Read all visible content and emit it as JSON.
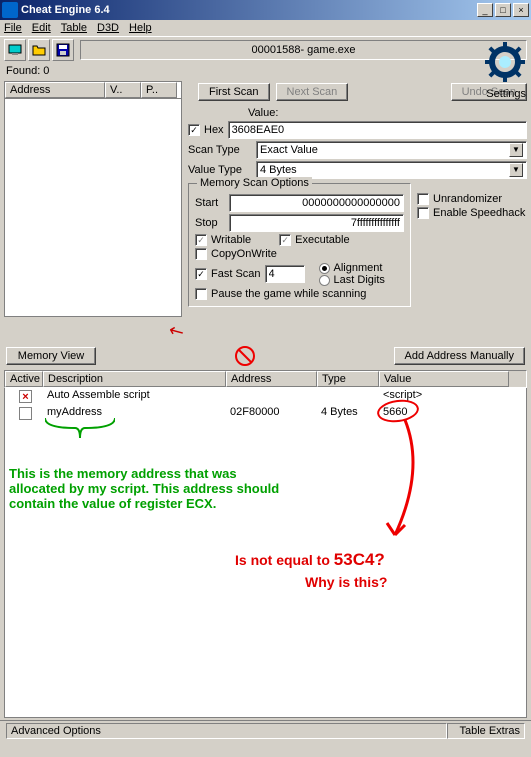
{
  "window": {
    "title": "Cheat Engine 6.4"
  },
  "menu": {
    "file": "File",
    "edit": "Edit",
    "table": "Table",
    "d3d": "D3D",
    "help": "Help"
  },
  "process": "00001588- game.exe",
  "settings": "Settings",
  "found": {
    "label": "Found: 0"
  },
  "list_headers": {
    "address": "Address",
    "value": "V..",
    "prev": "P.."
  },
  "buttons": {
    "first_scan": "First Scan",
    "next_scan": "Next Scan",
    "undo_scan": "Undo Scan",
    "memory_view": "Memory View",
    "add_manual": "Add Address Manually",
    "advanced": "Advanced Options",
    "extras": "Table Extras"
  },
  "fields": {
    "value_label": "Value:",
    "hex": "Hex",
    "value": "3608EAE0",
    "scan_type_label": "Scan Type",
    "scan_type": "Exact Value",
    "value_type_label": "Value Type",
    "value_type": "4 Bytes"
  },
  "mem_opts": {
    "legend": "Memory Scan Options",
    "start_label": "Start",
    "start": "0000000000000000",
    "stop_label": "Stop",
    "stop": "7fffffffffffffff",
    "writable": "Writable",
    "executable": "Executable",
    "copyonwrite": "CopyOnWrite",
    "fast_scan": "Fast Scan",
    "fast_scan_val": "4",
    "alignment": "Alignment",
    "last_digits": "Last Digits",
    "pause": "Pause the game while scanning"
  },
  "right_opts": {
    "unrandomizer": "Unrandomizer",
    "speedhack": "Enable Speedhack"
  },
  "table": {
    "headers": {
      "active": "Active",
      "desc": "Description",
      "addr": "Address",
      "type": "Type",
      "value": "Value"
    },
    "rows": [
      {
        "active": true,
        "desc": "Auto Assemble script",
        "addr": "",
        "type": "",
        "value": "<script>"
      },
      {
        "active": false,
        "desc": "myAddress",
        "addr": "02F80000",
        "type": "4 Bytes",
        "value": "5660"
      }
    ]
  },
  "annotations": {
    "green": "This is the memory address that was\nallocated by my script. This address should\ncontain the value of register ECX.",
    "red1": "Is not equal to",
    "red_hex": "53C4?",
    "red2": "Why is this?"
  }
}
